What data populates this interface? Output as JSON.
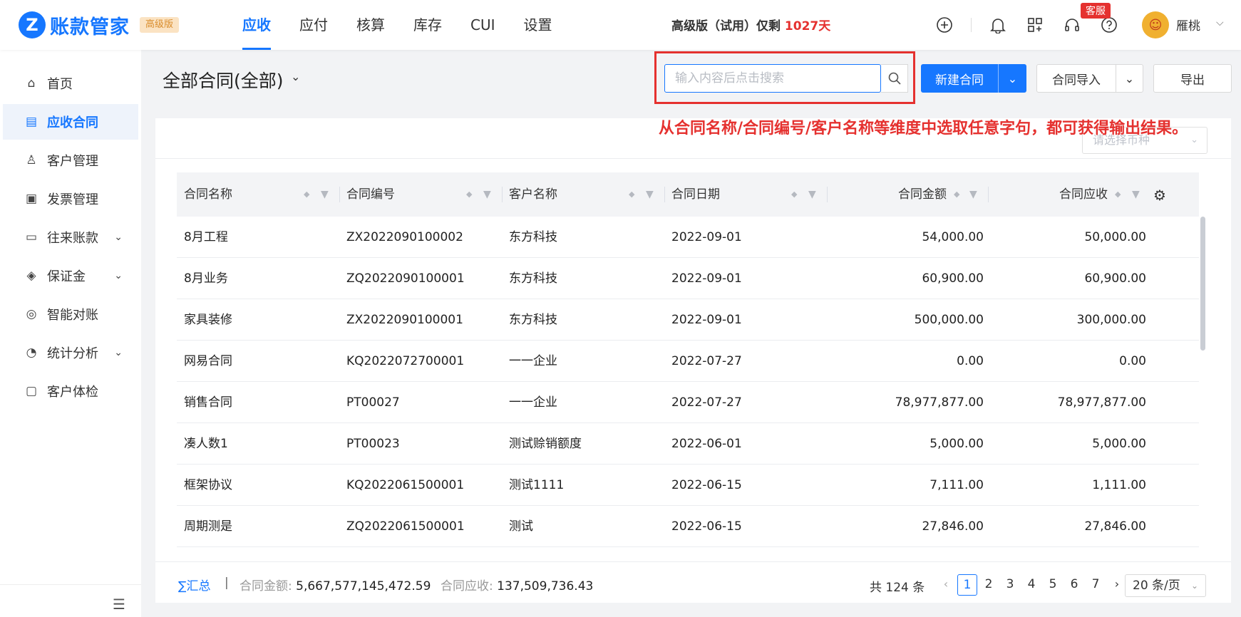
{
  "header": {
    "logo_letter": "Z",
    "brand": "账款管家",
    "edition": "高级版",
    "nav": [
      {
        "label": "应收",
        "active": true
      },
      {
        "label": "应付"
      },
      {
        "label": "核算"
      },
      {
        "label": "库存"
      },
      {
        "label": "CUI"
      },
      {
        "label": "设置"
      }
    ],
    "trial_prefix": "高级版（试用）仅剩 ",
    "trial_days": "1027天",
    "support_badge": "客服",
    "user_name": "雁桃"
  },
  "sidebar": {
    "items": [
      {
        "label": "首页",
        "icon": "home-icon"
      },
      {
        "label": "应收合同",
        "icon": "contract-icon",
        "active": true
      },
      {
        "label": "客户管理",
        "icon": "user-icon"
      },
      {
        "label": "发票管理",
        "icon": "invoice-icon"
      },
      {
        "label": "往来账款",
        "icon": "ledger-icon",
        "expandable": true
      },
      {
        "label": "保证金",
        "icon": "deposit-icon",
        "expandable": true
      },
      {
        "label": "智能对账",
        "icon": "reconcile-icon"
      },
      {
        "label": "统计分析",
        "icon": "chart-icon",
        "expandable": true
      },
      {
        "label": "客户体检",
        "icon": "monitor-icon"
      }
    ]
  },
  "main": {
    "title": "全部合同(全部)",
    "search_placeholder": "输入内容后点击搜索",
    "new_button": "新建合同",
    "import_button": "合同导入",
    "export_button": "导出",
    "currency_placeholder": "请选择币种",
    "annotation": "从合同名称/合同编号/客户名称等维度中选取任意字句，都可获得输出结果。"
  },
  "table": {
    "columns": [
      "合同名称",
      "合同编号",
      "客户名称",
      "合同日期",
      "合同金额",
      "合同应收"
    ],
    "rows": [
      [
        "8月工程",
        "ZX2022090100002",
        "东方科技",
        "2022-09-01",
        "54,000.00",
        "50,000.00"
      ],
      [
        "8月业务",
        "ZQ2022090100001",
        "东方科技",
        "2022-09-01",
        "60,900.00",
        "60,900.00"
      ],
      [
        "家具装修",
        "ZX2022090100001",
        "东方科技",
        "2022-09-01",
        "500,000.00",
        "300,000.00"
      ],
      [
        "网易合同",
        "KQ2022072700001",
        "一一企业",
        "2022-07-27",
        "0.00",
        "0.00"
      ],
      [
        "销售合同",
        "PT00027",
        "一一企业",
        "2022-07-27",
        "78,977,877.00",
        "78,977,877.00"
      ],
      [
        "凑人数1",
        "PT00023",
        "测试赊销额度",
        "2022-06-01",
        "5,000.00",
        "5,000.00"
      ],
      [
        "框架协议",
        "KQ2022061500001",
        "测试1111",
        "2022-06-15",
        "7,111.00",
        "1,111.00"
      ],
      [
        "周期测是",
        "ZQ2022061500001",
        "测试",
        "2022-06-15",
        "27,846.00",
        "27,846.00"
      ]
    ]
  },
  "footer": {
    "sum_label": "∑汇总",
    "sum_sep": "|",
    "amount_label": "合同金额:",
    "amount_value": "5,667,577,145,472.59",
    "receivable_label": "合同应收:",
    "receivable_value": "137,509,736.43",
    "total": "共 124 条",
    "pages": [
      "1",
      "2",
      "3",
      "4",
      "5",
      "6",
      "7"
    ],
    "current_page": "1",
    "page_size": "20 条/页"
  },
  "colors": {
    "accent": "#1677ff",
    "alert": "#e5312f"
  }
}
